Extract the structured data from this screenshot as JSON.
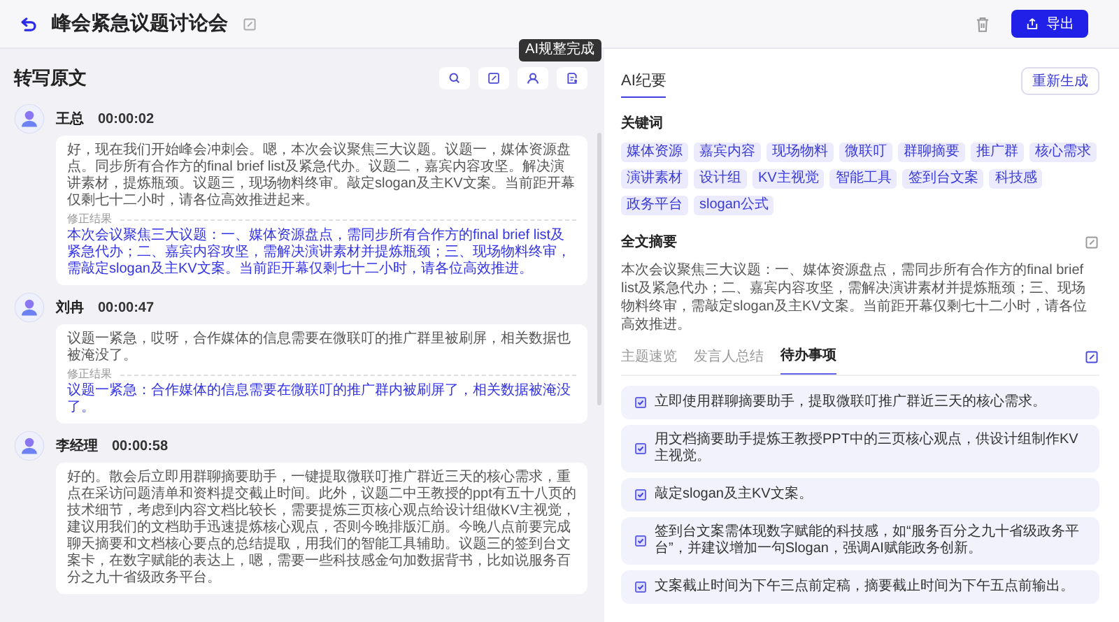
{
  "header": {
    "title": "峰会紧急议题讨论会",
    "export_button": "导出"
  },
  "transcript": {
    "title": "转写原文",
    "tooltip": "AI规整完成",
    "entries": [
      {
        "speaker": "王总",
        "time": "00:00:02",
        "text": "好，现在我们开始峰会冲刺会。嗯，本次会议聚焦三大议题。议题一，媒体资源盘点。同步所有合作方的final brief list及紧急代办。议题二，嘉宾内容攻坚。解决演讲素材，提炼瓶颈。议题三，现场物料终审。敲定slogan及主KV文案。当前距开幕仅剩七十二小时，请各位高效推进起来。",
        "correction_label": "修正结果",
        "corrected": "本次会议聚焦三大议题：一、媒体资源盘点，需同步所有合作方的final brief list及紧急代办；二、嘉宾内容攻坚，需解决演讲素材并提炼瓶颈；三、现场物料终审，需敲定slogan及主KV文案。当前距开幕仅剩七十二小时，请各位高效推进。"
      },
      {
        "speaker": "刘冉",
        "time": "00:00:47",
        "text": "议题一紧急，哎呀，合作媒体的信息需要在微联叮的推广群里被刷屏，相关数据也被淹没了。",
        "correction_label": "修正结果",
        "corrected": "议题一紧急：合作媒体的信息需要在微联叮的推广群内被刷屏了，相关数据被淹没了。"
      },
      {
        "speaker": "李经理",
        "time": "00:00:58",
        "text": "好的。散会后立即用群聊摘要助手，一键提取微联叮推广群近三天的核心需求，重点在采访问题清单和资料提交截止时间。此外，议题二中王教授的ppt有五十八页的技术细节，考虑到内容文档比较长，需要提炼三页核心观点给设计组做KV主视觉，建议用我们的文档助手迅速提炼核心观点，否则今晚排版汇崩。今晚八点前要完成聊天摘要和文档核心要点的总结提取，用我们的智能工具辅助。议题三的签到台文案卡，在数字赋能的表达上，嗯，需要一些科技感金句加数据背书，比如说服务百分之九十省级政务平台。"
      }
    ]
  },
  "minutes": {
    "tabs": [
      {
        "label": "AI纪要",
        "selected": true
      }
    ],
    "regenerate_button": "重新生成",
    "keywords_title": "关键词",
    "keywords": [
      "媒体资源",
      "嘉宾内容",
      "现场物料",
      "微联叮",
      "群聊摘要",
      "推广群",
      "核心需求",
      "演讲素材",
      "设计组",
      "KV主视觉",
      "智能工具",
      "签到台文案",
      "科技感",
      "政务平台",
      "slogan公式"
    ],
    "summary_title": "全文摘要",
    "summary": "本次会议聚焦三大议题：一、媒体资源盘点，需同步所有合作方的final brief list及紧急代办；二、嘉宾内容攻坚，需解决演讲素材并提炼瓶颈；三、现场物料终审，需敲定slogan及主KV文案。当前距开幕仅剩七十二小时，请各位高效推进。",
    "subtabs": [
      {
        "label": "主题速览",
        "selected": false
      },
      {
        "label": "发言人总结",
        "selected": false
      },
      {
        "label": "待办事项",
        "selected": true
      }
    ],
    "todos": [
      {
        "text": "立即使用群聊摘要助手，提取微联叮推广群近三天的核心需求。",
        "checked": true
      },
      {
        "text": "用文档摘要助手提炼王教授PPT中的三页核心观点，供设计组制作KV主视觉。",
        "checked": true
      },
      {
        "text": "敲定slogan及主KV文案。",
        "checked": true
      },
      {
        "text": "签到台文案需体现数字赋能的科技感，如“服务百分之九十省级政务平台”，并建议增加一句Slogan，强调AI赋能政务创新。",
        "checked": true
      },
      {
        "text": "文案截止时间为下午三点前定稿，摘要截止时间为下午五点前输出。",
        "checked": true
      }
    ]
  }
}
